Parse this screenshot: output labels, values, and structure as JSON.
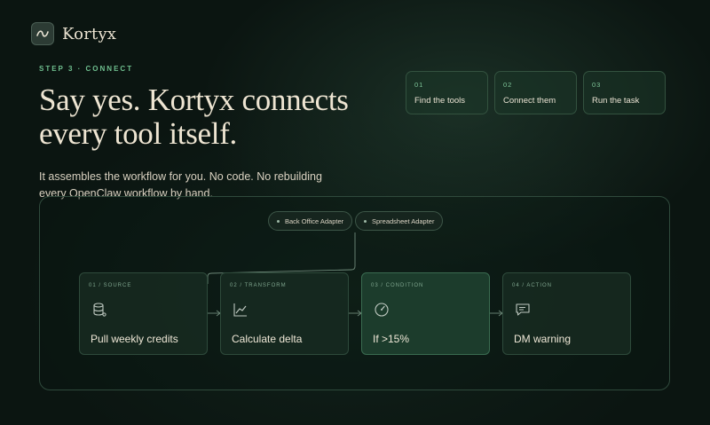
{
  "brand": {
    "name": "Kortyx",
    "icon": "infinity-leaf-icon"
  },
  "hero": {
    "step_label": "STEP 3 · CONNECT",
    "headline": "Say yes. Kortyx connects every tool itself.",
    "subtitle": "It assembles the workflow for you. No code. No rebuilding every OpenClaw workflow by hand."
  },
  "steps": [
    {
      "num": "01",
      "title": "Find the tools"
    },
    {
      "num": "02",
      "title": "Connect them"
    },
    {
      "num": "03",
      "title": "Run the task"
    }
  ],
  "adapters": [
    {
      "label": "Back Office Adapter"
    },
    {
      "label": "Spreadsheet Adapter"
    }
  ],
  "workflow": [
    {
      "label": "01 / SOURCE",
      "title": "Pull weekly credits",
      "icon": "database-icon"
    },
    {
      "label": "02 / TRANSFORM",
      "title": "Calculate delta",
      "icon": "trend-chart-icon"
    },
    {
      "label": "03 / CONDITION",
      "title": "If >15%",
      "icon": "gauge-icon"
    },
    {
      "label": "04 / ACTION",
      "title": "DM warning",
      "icon": "message-icon"
    }
  ],
  "colors": {
    "accent": "#6fbf8f",
    "background": "#0b1511",
    "text": "#eee5d2"
  }
}
